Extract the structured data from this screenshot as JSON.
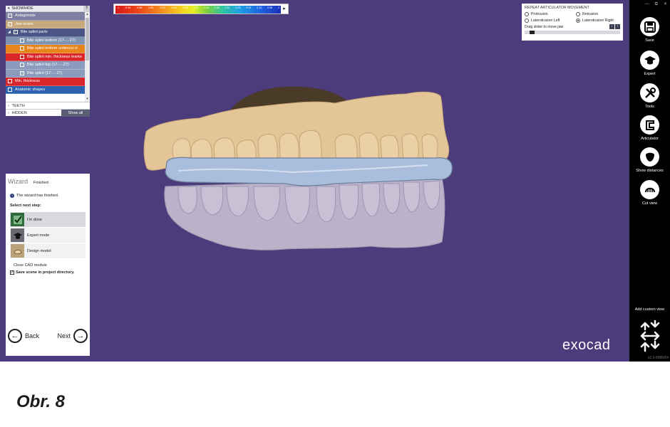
{
  "showhide": {
    "title": "SHOWHIDE",
    "help": "?",
    "items": [
      {
        "label": "Antagonists",
        "checked": true,
        "color": "#7f7fa2",
        "indent": false
      },
      {
        "label": "Jaw scans",
        "checked": true,
        "color": "#c8a77a",
        "indent": false
      },
      {
        "label": "Bite splint parts",
        "checked": true,
        "color": "#4a5586",
        "indent": false,
        "expander": "◢"
      },
      {
        "label": "Bite splint bottom (17-...-27)",
        "checked": false,
        "color": "#7f93b3",
        "indent": true
      },
      {
        "label": "Bite splint bottom undercut vi",
        "checked": false,
        "color": "#e8841c",
        "indent": true
      },
      {
        "label": "Bite splint min. thickness marke",
        "checked": false,
        "color": "#d9262a",
        "indent": true
      },
      {
        "label": "Bite splint top (17-...-27)",
        "checked": false,
        "color": "#8a9bbd",
        "indent": true
      },
      {
        "label": "Bite splint (17-...-27)",
        "checked": true,
        "color": "#8a9bbd",
        "indent": true
      },
      {
        "label": "Min. thickness",
        "checked": false,
        "color": "#d9262a",
        "indent": false
      },
      {
        "label": "Anatomic shapes",
        "checked": false,
        "color": "#2c62b0",
        "indent": false
      }
    ],
    "teeth_label": "TEETH",
    "hidden_label": "HIDDEN",
    "show_all_label": "Show all"
  },
  "color_scale": {
    "ticks": [
      "-1",
      "-0.94",
      "-0.88",
      "-0.81",
      "-0.75",
      "-0.69",
      "-0.63",
      "-0.5",
      "0.44",
      "0.38",
      "0.31",
      "0.25",
      "0.19",
      "0.12",
      "0.06",
      "0"
    ]
  },
  "articulator": {
    "title": "REPEAT ARTICULATOR MOVEMENT",
    "options": [
      {
        "label": "Protrusion",
        "selected": false
      },
      {
        "label": "Retrusion",
        "selected": false
      },
      {
        "label": "Laterotrusion Left",
        "selected": false
      },
      {
        "label": "Laterotrusion Right",
        "selected": true
      }
    ],
    "drag_label": "Drag slider to move jaw",
    "slider_value": 0.05
  },
  "wizard": {
    "title": "Wizard",
    "status": "Finished",
    "info_text": "The wizard has finished.",
    "select_next_label": "Select next step:",
    "steps": [
      {
        "label": "I'm done",
        "icon": "check-icon"
      },
      {
        "label": "Expert mode",
        "icon": "expert-mode-icon"
      },
      {
        "label": "Design model",
        "icon": "design-model-icon"
      }
    ],
    "close_label": "Close CAD module",
    "save_scene_label": "Save scene in project directory.",
    "save_scene_checked": true,
    "back_label": "Back",
    "next_label": "Next"
  },
  "toolbar": {
    "window_buttons": [
      "—",
      "⧉",
      "✕"
    ],
    "items": [
      {
        "label": "Save",
        "icon": "save-disk-icon"
      },
      {
        "label": "Expert",
        "icon": "expert-hat-icon"
      },
      {
        "label": "Tools",
        "icon": "tools-icon"
      },
      {
        "label": "Articulator",
        "icon": "articulator-icon"
      },
      {
        "label": "Show distances",
        "icon": "show-distances-icon"
      },
      {
        "label": "Cut view",
        "icon": "cut-view-icon"
      }
    ],
    "custom_view_label": "Add custom view",
    "version": "v2.3-9090/64"
  },
  "logo_text": "exocad",
  "caption": "Obr. 8",
  "colors": {
    "viewport_bg": "#4d3c7b",
    "toolbar_bg": "#000000",
    "upper_jaw": "#e3c597",
    "splint": "#a8bedc",
    "lower_jaw": "#b9b2c8"
  }
}
